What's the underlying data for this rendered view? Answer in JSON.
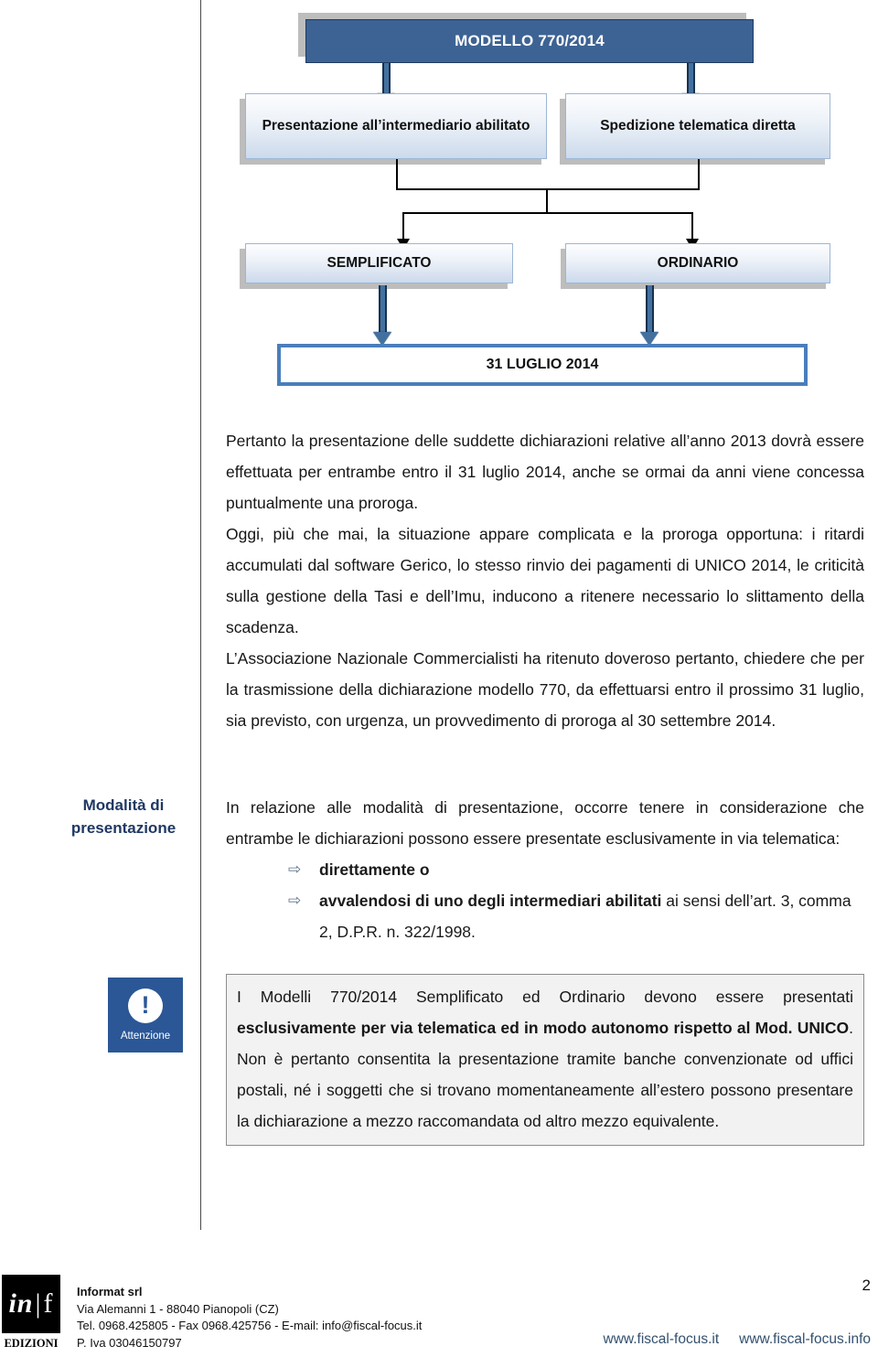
{
  "diagram": {
    "root": {
      "label": "MODELLO 770/2014"
    },
    "level2": [
      {
        "label": "Presentazione all’intermediario abilitato"
      },
      {
        "label": "Spedizione telematica diretta"
      }
    ],
    "level3": [
      {
        "label": "SEMPLIFICATO"
      },
      {
        "label": "ORDINARIO"
      }
    ],
    "deadline": {
      "label": "31 LUGLIO 2014"
    }
  },
  "body": {
    "paragraphs": [
      "Pertanto la presentazione delle suddette dichiarazioni relative all’anno 2013 dovrà essere effettuata per entrambe entro il 31 luglio 2014, anche se ormai da anni viene concessa puntualmente una proroga.",
      "Oggi, più che mai, la situazione appare complicata e la proroga opportuna: i ritardi accumulati dal software Gerico, lo stesso rinvio dei pagamenti di UNICO 2014, le criticità sulla gestione della Tasi e dell’Imu, inducono a ritenere necessario lo slittamento della scadenza.",
      "L’Associazione Nazionale Commercialisti ha ritenuto doveroso pertanto, chiedere che per la trasmissione della dichiarazione modello 770, da effettuarsi entro il prossimo 31 luglio, sia previsto, con urgenza, un provvedimento di proroga al 30 settembre 2014."
    ]
  },
  "modalita": {
    "side_label_line1": "Modalità di",
    "side_label_line2": "presentazione",
    "intro": "In relazione alle modalità di presentazione, occorre tenere in considerazione che entrambe le dichiarazioni possono essere presentate esclusivamente in via telematica:",
    "bullet_glyph": "⇨",
    "bullets": [
      {
        "bold": "direttamente o",
        "rest": ""
      },
      {
        "bold": "avvalendosi di uno degli intermediari abilitati",
        "rest": " ai sensi dell’art. 3, comma 2, D.P.R. n. 322/1998."
      }
    ]
  },
  "attention": {
    "icon_caption": "Attenzione",
    "icon_glyph": "!",
    "text_part1": "I Modelli 770/2014 Semplificato ed Ordinario devono essere presentati ",
    "text_bold": "esclusivamente per via telematica ed in modo autonomo rispetto al Mod. UNICO",
    "text_part2": ". Non è pertanto consentita la presentazione tramite banche convenzionate od uffici postali, né i soggetti che si trovano momentaneamente all’estero possono presentare la dichiarazione a mezzo raccomandata od altro mezzo equivalente."
  },
  "footer": {
    "logo_text_1": "in",
    "logo_bar": "|",
    "logo_text_2": "f",
    "logo_sub": "EDIZIONI",
    "company": "Informat srl",
    "address": "Via Alemanni 1 - 88040 Pianopoli (CZ)",
    "contacts": "Tel. 0968.425805 - Fax 0968.425756 - E-mail: info@fiscal-focus.it",
    "vat": "P. Iva 03046150797",
    "link1": "www.fiscal-focus.it",
    "link2": "www.fiscal-focus.info",
    "page_number": "2"
  },
  "colors": {
    "header_blue": "#3d6394",
    "box_border_blue": "#9db6d4",
    "deadline_border": "#4a7ebb",
    "heading_navy": "#1f3864",
    "attention_blue": "#2b5797",
    "link_blue": "#33506e"
  }
}
